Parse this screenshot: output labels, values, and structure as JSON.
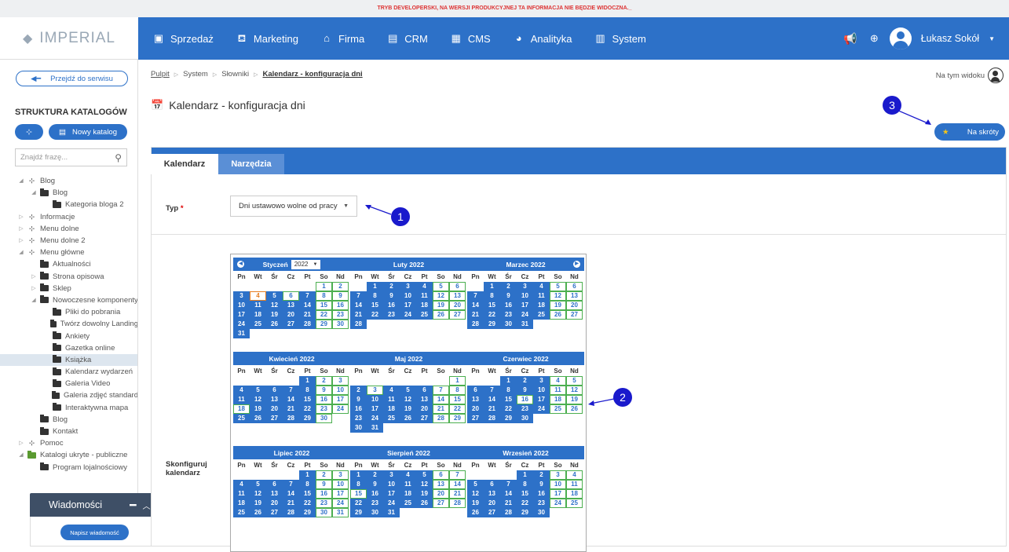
{
  "dev_banner": "TRYB DEVELOPERSKI, NA WERSJI PRODUKCYJNEJ TA INFORMACJA NIE BĘDZIE WIDOCZNA._",
  "logo": "IMPERIAL",
  "nav": {
    "items": [
      {
        "label": "Sprzedaż",
        "icon": "box-icon"
      },
      {
        "label": "Marketing",
        "icon": "presentation-icon"
      },
      {
        "label": "Firma",
        "icon": "building-icon"
      },
      {
        "label": "CRM",
        "icon": "file-icon"
      },
      {
        "label": "CMS",
        "icon": "layout-icon"
      },
      {
        "label": "Analityka",
        "icon": "pie-icon"
      },
      {
        "label": "System",
        "icon": "table-icon"
      }
    ],
    "user": "Łukasz Sokół"
  },
  "sidebar": {
    "back_button": "Przejdź do serwisu",
    "title": "STRUKTURA KATALOGÓW",
    "new_catalog": "Nowy katalog",
    "search_placeholder": "Znajdź frazę...",
    "tree": [
      {
        "label": "Blog",
        "level": 0,
        "type": "hier",
        "toggle": "◢"
      },
      {
        "label": "Blog",
        "level": 1,
        "type": "folder",
        "toggle": "◢"
      },
      {
        "label": "Kategoria bloga 2",
        "level": 2,
        "type": "folder",
        "toggle": ""
      },
      {
        "label": "Informacje",
        "level": 0,
        "type": "hier",
        "toggle": "▷"
      },
      {
        "label": "Menu dolne",
        "level": 0,
        "type": "hier",
        "toggle": "▷"
      },
      {
        "label": "Menu dolne 2",
        "level": 0,
        "type": "hier",
        "toggle": "▷"
      },
      {
        "label": "Menu główne",
        "level": 0,
        "type": "hier",
        "toggle": "◢"
      },
      {
        "label": "Aktualności",
        "level": 1,
        "type": "folder",
        "toggle": ""
      },
      {
        "label": "Strona opisowa",
        "level": 1,
        "type": "folder",
        "toggle": "▷"
      },
      {
        "label": "Sklep",
        "level": 1,
        "type": "folder",
        "toggle": "▷"
      },
      {
        "label": "Nowoczesne komponenty",
        "level": 1,
        "type": "folder",
        "toggle": "◢"
      },
      {
        "label": "Pliki do pobrania",
        "level": 2,
        "type": "folder",
        "toggle": ""
      },
      {
        "label": "Twórz dowolny Landing",
        "level": 2,
        "type": "folder",
        "toggle": ""
      },
      {
        "label": "Ankiety",
        "level": 2,
        "type": "folder",
        "toggle": ""
      },
      {
        "label": "Gazetka online",
        "level": 2,
        "type": "folder",
        "toggle": ""
      },
      {
        "label": "Książka",
        "level": 2,
        "type": "folder",
        "toggle": "",
        "selected": true
      },
      {
        "label": "Kalendarz wydarzeń",
        "level": 2,
        "type": "folder",
        "toggle": ""
      },
      {
        "label": "Galeria Video",
        "level": 2,
        "type": "folder",
        "toggle": ""
      },
      {
        "label": "Galeria zdjęć standard",
        "level": 2,
        "type": "folder",
        "toggle": ""
      },
      {
        "label": "Interaktywna mapa",
        "level": 2,
        "type": "folder",
        "toggle": ""
      },
      {
        "label": "Blog",
        "level": 1,
        "type": "folder",
        "toggle": ""
      },
      {
        "label": "Kontakt",
        "level": 1,
        "type": "folder",
        "toggle": ""
      },
      {
        "label": "Pomoc",
        "level": 0,
        "type": "hier",
        "toggle": "▷"
      },
      {
        "label": "Katalogi ukryte - publiczne",
        "level": 0,
        "type": "greenfolder",
        "toggle": "◢"
      },
      {
        "label": "Program lojalnościowy",
        "level": 1,
        "type": "folder",
        "toggle": ""
      }
    ]
  },
  "messages": {
    "title": "Wiadomości",
    "button": "Napisz wiadomość"
  },
  "breadcrumb": [
    "Pulpit",
    "System",
    "Słowniki",
    "Kalendarz - konfiguracja dni"
  ],
  "view_label": "Na tym widoku",
  "page_title": "Kalendarz - konfiguracja dni",
  "shortcut": "Na skróty",
  "markers": [
    "1",
    "2",
    "3"
  ],
  "tabs": [
    "Kalendarz",
    "Narzędzia"
  ],
  "form": {
    "type_label": "Typ",
    "type_required": "*",
    "type_value": "Dni ustawowo wolne od pracy",
    "calendar_label_1": "Skonfiguruj",
    "calendar_label_2": "kalendarz"
  },
  "calendar": {
    "year": "2022",
    "dow": [
      "Pn",
      "Wt",
      "Śr",
      "Cz",
      "Pt",
      "So",
      "Nd"
    ],
    "months": [
      {
        "name": "Styczeń",
        "offset": 5,
        "days": 31,
        "today": 4,
        "special": [
          1,
          6
        ]
      },
      {
        "name": "Luty 2022",
        "offset": 1,
        "days": 28,
        "special": []
      },
      {
        "name": "Marzec 2022",
        "offset": 1,
        "days": 31,
        "special": []
      },
      {
        "name": "Kwiecień 2022",
        "offset": 4,
        "days": 30,
        "special": [
          18
        ]
      },
      {
        "name": "Maj 2022",
        "offset": 6,
        "days": 31,
        "special": [
          3
        ]
      },
      {
        "name": "Czerwiec 2022",
        "offset": 2,
        "days": 30,
        "special": [
          16
        ]
      },
      {
        "name": "Lipiec 2022",
        "offset": 4,
        "days": 31,
        "special": []
      },
      {
        "name": "Sierpień 2022",
        "offset": 0,
        "days": 31,
        "special": [
          15
        ]
      },
      {
        "name": "Wrzesień 2022",
        "offset": 3,
        "days": 30,
        "special": []
      }
    ]
  }
}
